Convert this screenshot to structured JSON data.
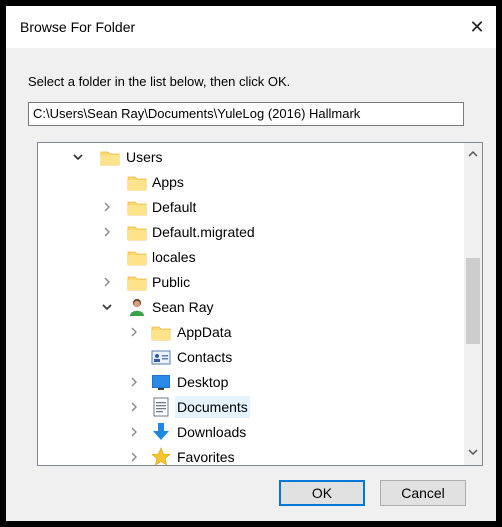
{
  "dialog": {
    "title": "Browse For Folder",
    "close_label": "✕",
    "instruction": "Select a folder in the list below, then click OK.",
    "path": "C:\\Users\\Sean Ray\\Documents\\YuleLog (2016) Hallmark"
  },
  "tree": {
    "items": [
      {
        "label": "Users",
        "icon": "folder-icon",
        "expanded": true
      },
      {
        "label": "Apps",
        "icon": "folder-icon"
      },
      {
        "label": "Default",
        "icon": "folder-icon"
      },
      {
        "label": "Default.migrated",
        "icon": "folder-icon"
      },
      {
        "label": "locales",
        "icon": "folder-icon"
      },
      {
        "label": "Public",
        "icon": "folder-icon"
      },
      {
        "label": "Sean Ray",
        "icon": "user-icon",
        "expanded": true
      },
      {
        "label": "AppData",
        "icon": "folder-icon"
      },
      {
        "label": "Contacts",
        "icon": "contacts-icon"
      },
      {
        "label": "Desktop",
        "icon": "desktop-icon"
      },
      {
        "label": "Documents",
        "icon": "documents-icon",
        "selected": true
      },
      {
        "label": "Downloads",
        "icon": "downloads-icon"
      },
      {
        "label": "Favorites",
        "icon": "favorites-icon"
      }
    ]
  },
  "buttons": {
    "ok": "OK",
    "cancel": "Cancel"
  },
  "colors": {
    "selection": "#e5f3ff",
    "accent": "#0078d7",
    "folder": "#ffd96b"
  }
}
